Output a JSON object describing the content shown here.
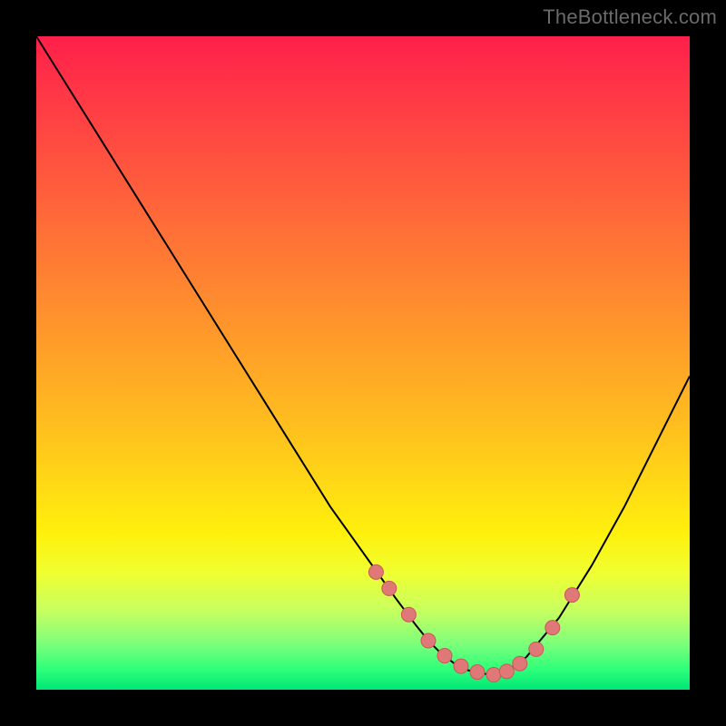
{
  "watermark": "TheBottleneck.com",
  "colors": {
    "background": "#000000",
    "curve_stroke": "#000000",
    "marker_fill": "#e07878",
    "marker_stroke": "#c85858"
  },
  "chart_data": {
    "type": "line",
    "title": "",
    "xlabel": "",
    "ylabel": "",
    "xlim": [
      0,
      100
    ],
    "ylim": [
      0,
      100
    ],
    "series": [
      {
        "name": "bottleneck-curve",
        "x": [
          0,
          5,
          10,
          15,
          20,
          25,
          30,
          35,
          40,
          45,
          50,
          55,
          58,
          60,
          62,
          64,
          66,
          68,
          70,
          72,
          75,
          80,
          85,
          90,
          95,
          100
        ],
        "values": [
          100,
          92,
          84,
          76,
          68,
          60,
          52,
          44,
          36,
          28,
          21,
          14,
          10,
          7.5,
          5.5,
          4.0,
          3.0,
          2.5,
          2.3,
          2.8,
          5.0,
          11.0,
          19.0,
          28.0,
          38.0,
          48.0
        ]
      }
    ],
    "markers": {
      "name": "highlight-dots",
      "x": [
        52.0,
        54.0,
        57.0,
        60.0,
        62.5,
        65.0,
        67.5,
        70.0,
        72.0,
        74.0,
        76.5,
        79.0,
        82.0
      ],
      "values": [
        18.0,
        15.5,
        11.5,
        7.5,
        5.2,
        3.6,
        2.7,
        2.3,
        2.8,
        4.0,
        6.2,
        9.5,
        14.5
      ]
    }
  }
}
